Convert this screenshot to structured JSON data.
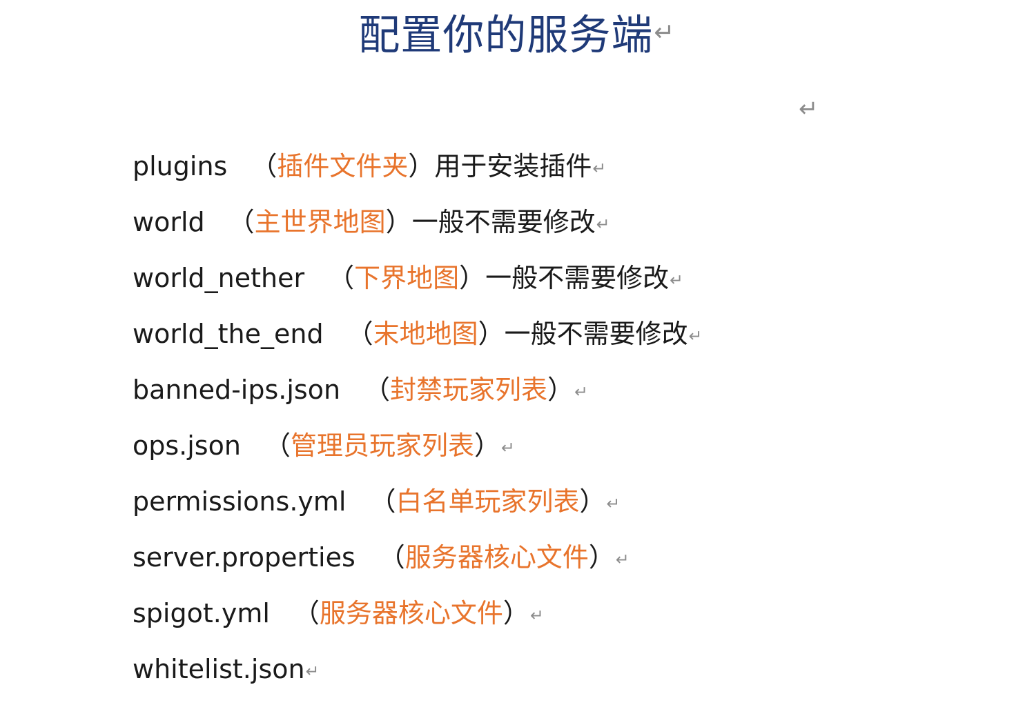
{
  "document": {
    "title": "配置你的服务端",
    "paragraph_mark": "↵",
    "entries": [
      {
        "file": "plugins",
        "highlight": "插件文件夹",
        "suffix": "用于安装插件"
      },
      {
        "file": "world",
        "highlight": "主世界地图",
        "suffix": "一般不需要修改"
      },
      {
        "file": "world_nether",
        "highlight": "下界地图",
        "suffix": "一般不需要修改"
      },
      {
        "file": "world_the_end",
        "highlight": "末地地图",
        "suffix": "一般不需要修改"
      },
      {
        "file": "banned-ips.json",
        "highlight": "封禁玩家列表",
        "suffix": ""
      },
      {
        "file": "ops.json",
        "highlight": "管理员玩家列表",
        "suffix": ""
      },
      {
        "file": "permissions.yml",
        "highlight": "白名单玩家列表",
        "suffix": ""
      },
      {
        "file": "server.properties",
        "highlight": "服务器核心文件",
        "suffix": ""
      },
      {
        "file": "spigot.yml",
        "highlight": "服务器核心文件",
        "suffix": ""
      },
      {
        "file": "whitelist.json",
        "highlight": "",
        "suffix": ""
      }
    ],
    "colors": {
      "title": "#1f3a78",
      "highlight": "#e8742c",
      "body_text": "#1a1a1a",
      "paragraph_mark": "#8c8c8c"
    }
  }
}
